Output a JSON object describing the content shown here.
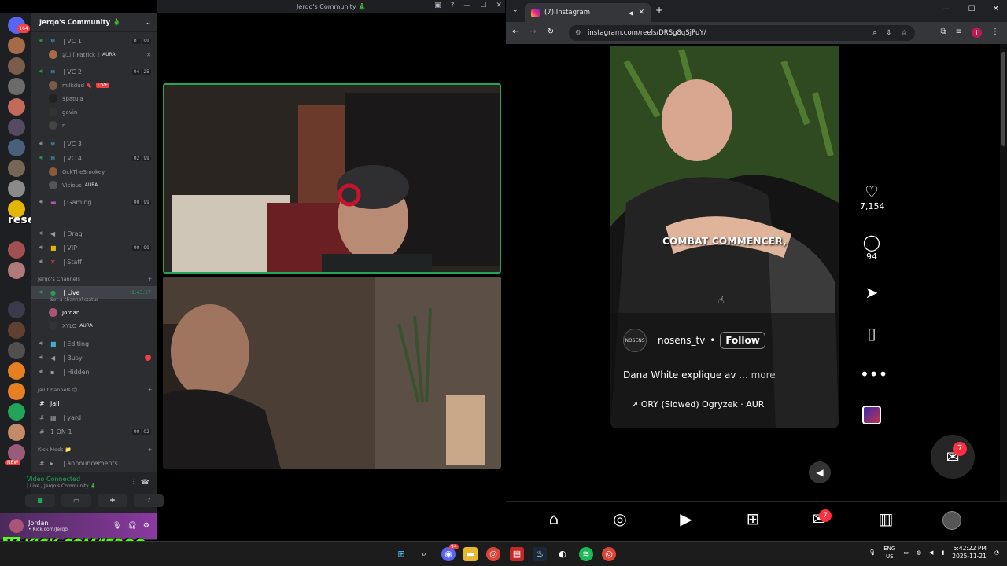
{
  "discord": {
    "window_title": "Jerqo's Community 🎄",
    "guild_name": "Jerqo's Community 🎄",
    "home_badge": "164",
    "overlay_text": "resecti",
    "channels": [
      {
        "name": "| VC 1",
        "counts": [
          "01",
          "99"
        ]
      },
      {
        "name": "| VC 2",
        "counts": [
          "04",
          "25"
        ]
      },
      {
        "name": "| VC 3",
        "counts": []
      },
      {
        "name": "| VC 4",
        "counts": [
          "02",
          "99"
        ]
      },
      {
        "name": "| Gaming",
        "counts": [
          "00",
          "99"
        ]
      },
      {
        "name": "| Drag",
        "counts": []
      },
      {
        "name": "| VIP",
        "counts": [
          "00",
          "99"
        ]
      },
      {
        "name": "| Staff",
        "counts": []
      },
      {
        "name": "| Live",
        "counts": []
      },
      {
        "name": "| Editing",
        "counts": []
      },
      {
        "name": "| Busy",
        "counts": []
      },
      {
        "name": "| Hidden",
        "counts": []
      },
      {
        "name": "jail",
        "counts": []
      },
      {
        "name": "| yard",
        "counts": []
      },
      {
        "name": "1 ON 1",
        "counts": [
          "00",
          "02"
        ]
      },
      {
        "name": "| announcements",
        "counts": []
      }
    ],
    "users": {
      "vc1_user": "ৡ㈡ [ Patrick ]",
      "vc2_user1": "milkdud 🔖",
      "vc2_user2": "$patula",
      "vc2_user3": "gavin",
      "vc2_user4": "n...",
      "vc4_user1": "OckTheSmokey",
      "vc4_user2": "Vicious",
      "live_user1": "Jordan",
      "live_user2": "XYLO"
    },
    "aura_tag": "AURA",
    "live_tag": "LIVE",
    "live_timer": "1:43:17",
    "live_status": "Set a channel status",
    "categories": {
      "jerqos": "Jerqo's Channels",
      "jail": "Jail Channels 😊",
      "kick": "Kick Mods 📁"
    },
    "voice": {
      "status": "Video Connected",
      "location": "| Live / Jerqo's Community 🎄"
    },
    "user": {
      "name": "Jordan",
      "status": "• Kick.com/Jerqo"
    },
    "new_label": "NEW"
  },
  "kick_banner": "KICK.COM/JERQO",
  "kick_logo": "K",
  "chrome": {
    "tab_title": "(7) Instagram",
    "url": "instagram.com/reels/DRSg8qSjPuY/",
    "profile_initial": "J"
  },
  "reel": {
    "subtitle": "COMBAT COMMENCER,",
    "username": "nosens_tv",
    "follow_label": "Follow",
    "description": "Dana White explique av",
    "more_label": "... more",
    "audio": "↗ ORY (Slowed)   Ogryzek · AUR",
    "avatar_text": "NOSENS",
    "likes": "7,154",
    "comments": "94",
    "messages_badge": "7",
    "nav_badge": "7"
  },
  "taskbar": {
    "lang": "ENG",
    "region": "US",
    "time": "5:42:22 PM",
    "date": "2025-11-21",
    "discord_badge": "94"
  },
  "colors": {
    "discord_green": "#23a559",
    "instagram_red": "#ff3040",
    "kick_green": "#53fc18"
  }
}
